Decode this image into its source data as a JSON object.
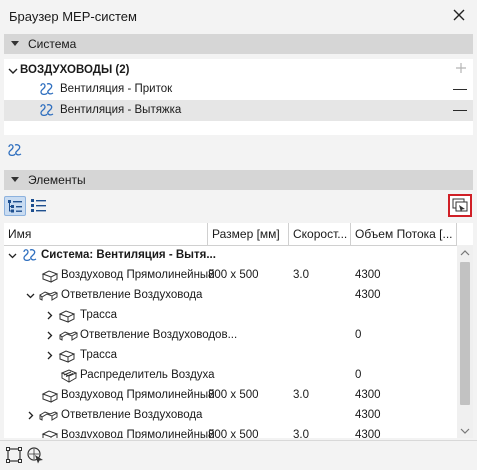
{
  "window": {
    "title": "Браузер MEP-систем"
  },
  "systems_section": {
    "label": "Система",
    "group": {
      "label": "ВОЗДУХОВОДЫ (2)"
    },
    "items": [
      {
        "label": "Вентиляция - Приток",
        "selected": false
      },
      {
        "label": "Вентиляция - Вытяжка",
        "selected": true
      }
    ]
  },
  "elements_section": {
    "label": "Элементы",
    "columns": [
      "Имя",
      "Размер [мм]",
      "Скорост...",
      "Объем Потока [..."
    ],
    "rows": [
      {
        "name": "Система: Вентиляция - Вытя...",
        "size": "",
        "speed": "",
        "flow": "",
        "level": 0,
        "expander": "open",
        "icon": "system-icon",
        "bold": true
      },
      {
        "name": "Воздуховод Прямолинейный",
        "size": "800 x 500",
        "speed": "3.0",
        "flow": "4300",
        "level": 1,
        "expander": "none",
        "icon": "duct-icon"
      },
      {
        "name": "Ответвление Воздуховода",
        "size": "",
        "speed": "",
        "flow": "4300",
        "level": 1,
        "expander": "open",
        "icon": "branch-icon"
      },
      {
        "name": "Трасса",
        "size": "",
        "speed": "",
        "flow": "",
        "level": 2,
        "expander": "closed",
        "icon": "route-icon"
      },
      {
        "name": "Ответвление Воздуховодов...",
        "size": "",
        "speed": "",
        "flow": "0",
        "level": 2,
        "expander": "closed",
        "icon": "branch-icon"
      },
      {
        "name": "Трасса",
        "size": "",
        "speed": "",
        "flow": "",
        "level": 2,
        "expander": "closed",
        "icon": "route-icon"
      },
      {
        "name": "Распределитель Воздуха",
        "size": "",
        "speed": "",
        "flow": "0",
        "level": 2,
        "expander": "none",
        "icon": "diffuser-icon"
      },
      {
        "name": "Воздуховод Прямолинейный",
        "size": "800 x 500",
        "speed": "3.0",
        "flow": "4300",
        "level": 1,
        "expander": "none",
        "icon": "duct-icon"
      },
      {
        "name": "Ответвление Воздуховода",
        "size": "",
        "speed": "",
        "flow": "4300",
        "level": 1,
        "expander": "closed",
        "icon": "branch-icon"
      },
      {
        "name": "Воздуховод Прямолинейный",
        "size": "800 x 500",
        "speed": "3.0",
        "flow": "4300",
        "level": 1,
        "expander": "none",
        "icon": "duct-icon"
      }
    ]
  }
}
